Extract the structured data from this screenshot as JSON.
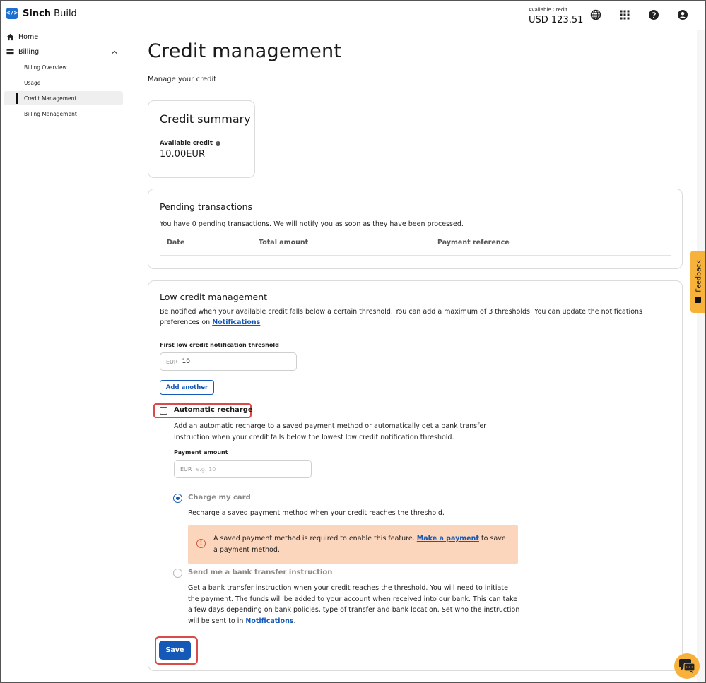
{
  "brand": {
    "logo_glyph": "</>",
    "name_bold": "Sinch",
    "name_rest": " Build"
  },
  "sidebar": {
    "home_label": "Home",
    "billing_label": "Billing",
    "items": [
      {
        "label": "Billing Overview"
      },
      {
        "label": "Usage"
      },
      {
        "label": "Credit Management",
        "active": true
      },
      {
        "label": "Billing Management"
      }
    ]
  },
  "header": {
    "credit_label": "Available Credit",
    "credit_value": "USD 123.51",
    "icons": [
      "globe-icon",
      "apps-grid-icon",
      "help-icon",
      "account-icon"
    ]
  },
  "page": {
    "title": "Credit management",
    "subtitle": "Manage your credit"
  },
  "summary": {
    "title": "Credit summary",
    "available_label": "Available credit",
    "available_value": "10.00EUR"
  },
  "pending": {
    "title": "Pending transactions",
    "description": "You have 0 pending transactions. We will notify you as soon as they have been processed.",
    "columns": [
      "Date",
      "Total amount",
      "Payment reference"
    ]
  },
  "low_credit": {
    "title": "Low credit management",
    "description": "Be notified when your available credit falls below a certain threshold. You can add a maximum of 3 thresholds. You can update the notifications preferences on ",
    "notifications_link": "Notifications",
    "threshold_label": "First low credit notification threshold",
    "threshold_currency": "EUR",
    "threshold_value": "10",
    "add_another": "Add another",
    "auto_recharge_label": "Automatic recharge",
    "auto_recharge_checked": false,
    "auto_recharge_desc": "Add an automatic recharge to a saved payment method or automatically get a bank transfer instruction when your credit falls below the lowest low credit notification threshold.",
    "payment_amount_label": "Payment amount",
    "payment_currency": "EUR",
    "payment_placeholder": "e.g. 10",
    "charge_card_label": "Charge my card",
    "charge_card_desc": "Recharge a saved payment method when your credit reaches the threshold.",
    "warning_text": "A saved payment method is required to enable this feature. ",
    "warning_link": "Make a payment",
    "warning_tail": " to save a payment method.",
    "bank_transfer_label": "Send me a bank transfer instruction",
    "bank_transfer_desc": "Get a bank transfer instruction when your credit reaches the threshold. You will need to initiate the payment. The funds will be added to your account when received into our bank. This can take a few days depending on bank policies, type of transfer and bank location. Set who the instruction will be sent to in ",
    "bank_transfer_link": "Notifications",
    "bank_transfer_tail": ".",
    "save_label": "Save"
  },
  "feedback_label": "Feedback",
  "colors": {
    "accent": "#1458b8",
    "feedback": "#f7b23b",
    "warning_bg": "#fcd5bd",
    "highlight": "#d94b48"
  }
}
